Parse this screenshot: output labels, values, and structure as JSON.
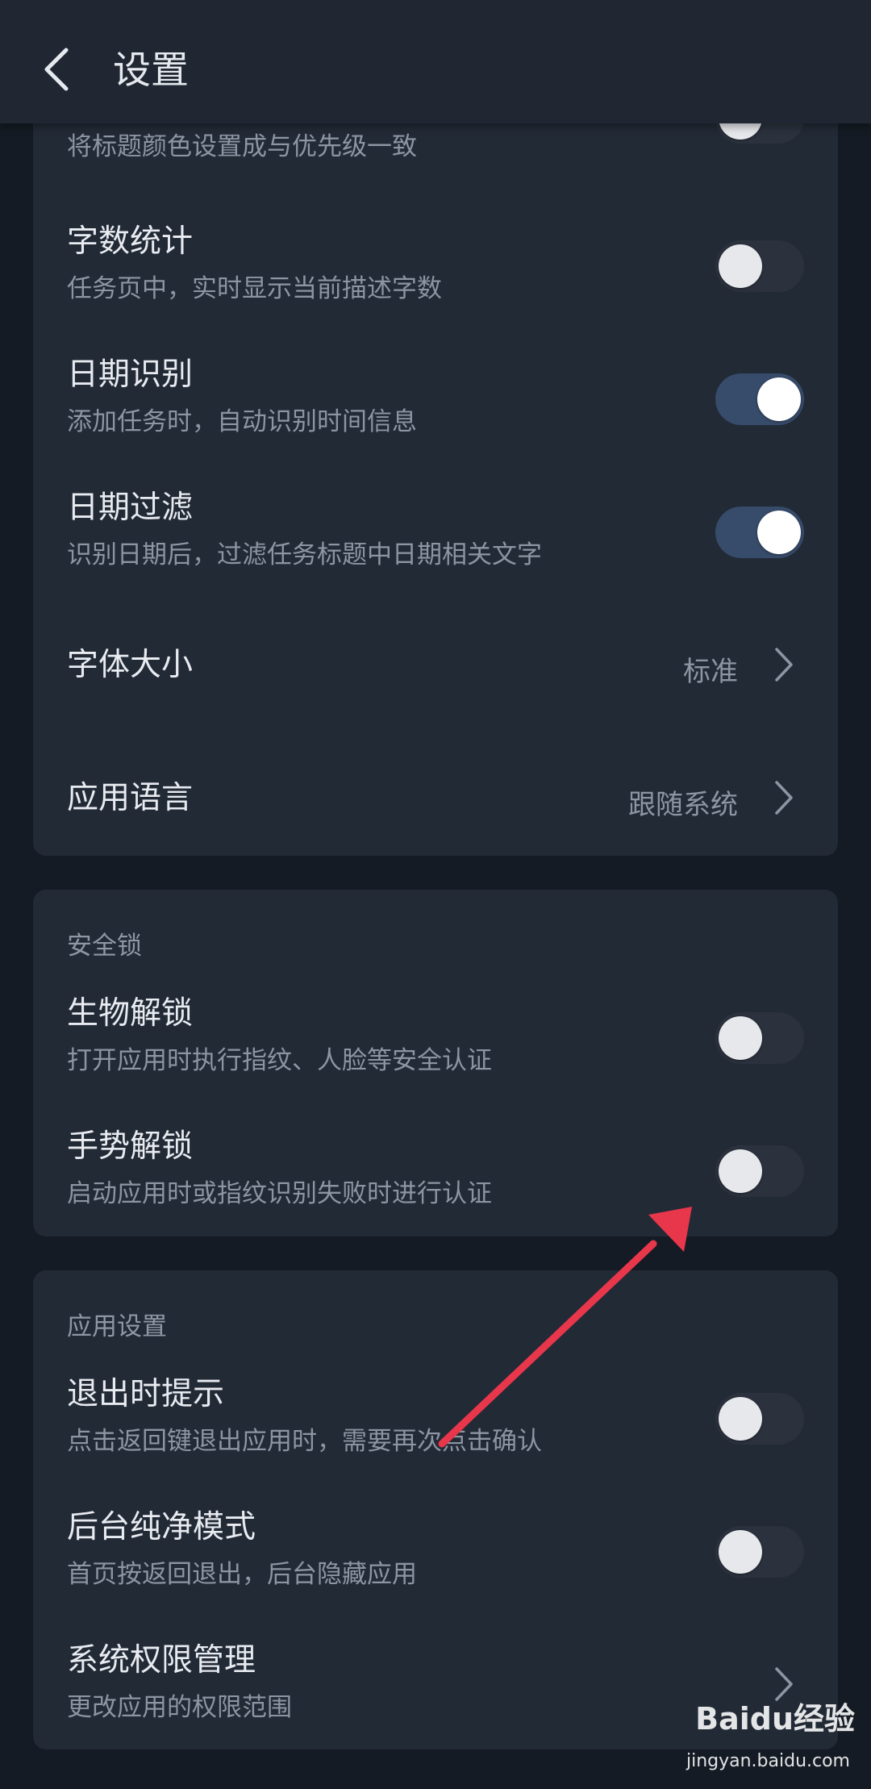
{
  "header": {
    "title": "设置",
    "back_icon": "chevron-left-icon"
  },
  "general": {
    "rows": [
      {
        "title": "",
        "subtitle": "将标题颜色设置成与优先级一致",
        "toggle": false
      },
      {
        "title": "字数统计",
        "subtitle": "任务页中，实时显示当前描述字数",
        "toggle": false
      },
      {
        "title": "日期识别",
        "subtitle": "添加任务时，自动识别时间信息",
        "toggle": true
      },
      {
        "title": "日期过滤",
        "subtitle": "识别日期后，过滤任务标题中日期相关文字",
        "toggle": true
      },
      {
        "title": "字体大小",
        "value": "标准",
        "icon": "chevron-right-icon"
      },
      {
        "title": "应用语言",
        "value": "跟随系统",
        "icon": "chevron-right-icon"
      }
    ]
  },
  "security": {
    "section_title": "安全锁",
    "rows": [
      {
        "title": "生物解锁",
        "subtitle": "打开应用时执行指纹、人脸等安全认证",
        "toggle": false
      },
      {
        "title": "手势解锁",
        "subtitle": "启动应用时或指纹识别失败时进行认证",
        "toggle": false
      }
    ]
  },
  "app_settings": {
    "section_title": "应用设置",
    "rows": [
      {
        "title": "退出时提示",
        "subtitle": "点击返回键退出应用时，需要再次点击确认",
        "toggle": false
      },
      {
        "title": "后台纯净模式",
        "subtitle": "首页按返回退出，后台隐藏应用",
        "toggle": false
      },
      {
        "title": "系统权限管理",
        "subtitle": "更改应用的权限范围",
        "icon": "chevron-right-icon"
      }
    ]
  },
  "annotation": {
    "icon": "red-arrow-icon",
    "color": "#e8364b"
  },
  "watermark": {
    "logo": "Baidu经验",
    "url": "jingyan.baidu.com"
  },
  "colors": {
    "background": "#151b24",
    "card": "#222a36",
    "toggle_on": "#374b6a",
    "toggle_off": "#2b323e"
  }
}
